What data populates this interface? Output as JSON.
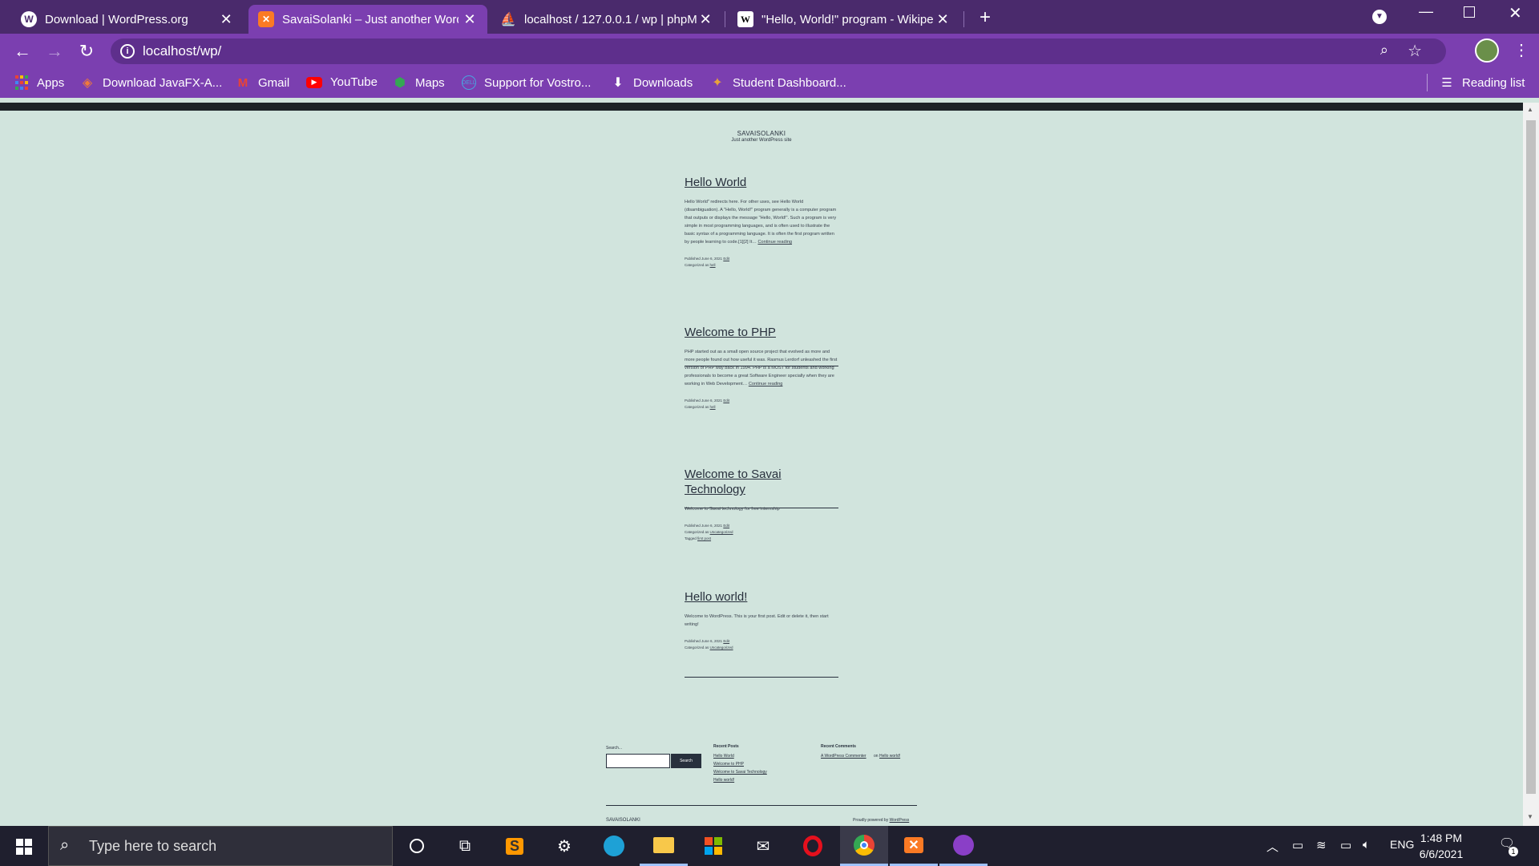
{
  "browser": {
    "tabs": [
      {
        "title": "Download | WordPress.org",
        "icon": "wordpress-icon",
        "active": false
      },
      {
        "title": "SavaiSolanki – Just another Word",
        "icon": "xampp-icon",
        "active": true
      },
      {
        "title": "localhost / 127.0.0.1 / wp | phpM",
        "icon": "phpmyadmin-icon",
        "active": false
      },
      {
        "title": "\"Hello, World!\" program - Wikipe",
        "icon": "wikipedia-icon",
        "active": false
      }
    ],
    "new_tab_symbol": "+",
    "url": "localhost/wp/"
  },
  "bookmarks": {
    "items": [
      {
        "label": "Apps",
        "icon": "apps-grid-icon"
      },
      {
        "label": "Download JavaFX-A...",
        "icon": "diamond-icon"
      },
      {
        "label": "Gmail",
        "icon": "gmail-icon"
      },
      {
        "label": "YouTube",
        "icon": "youtube-icon"
      },
      {
        "label": "Maps",
        "icon": "maps-icon"
      },
      {
        "label": "Support for Vostro...",
        "icon": "dell-icon"
      },
      {
        "label": "Downloads",
        "icon": "download-icon"
      },
      {
        "label": "Student Dashboard...",
        "icon": "dashboard-icon"
      }
    ],
    "reading_list": "Reading list"
  },
  "site": {
    "title": "SAVAISOLANKI",
    "description": "Just another WordPress site"
  },
  "posts": [
    {
      "title": "Hello World",
      "excerpt": "Hello World\" redirects here. For other uses, see Hello World (disambiguation). A \"Hello, World!\" program generally is a computer program that outputs or displays the message \"Hello, World!\". Such a program is very simple in most programming languages, and is often used to illustrate the basic syntax of a programming language. It is often the first program written by people learning to code.[1][2] It…",
      "continue": "Continue reading",
      "published": "Published June 6, 2021",
      "edit": "Edit",
      "categorized": "Categorized as",
      "category": "hell",
      "tagged": "",
      "tag": ""
    },
    {
      "title": "Welcome to PHP",
      "excerpt": "PHP started out as a small open source project that evolved as more and more people found out how useful it was. Rasmus Lerdorf unleashed the first version of PHP way back in 1994. PHP is a MUST for students and working professionals to become a great Software Engineer specially when they are working in Web Development…",
      "continue": "Continue reading",
      "published": "Published June 6, 2021",
      "edit": "Edit",
      "categorized": "Categorized as",
      "category": "hell",
      "tagged": "",
      "tag": ""
    },
    {
      "title": "Welcome to Savai Technology",
      "excerpt": "Welcome to Savai technology for free internship",
      "continue": "",
      "published": "Published June 6, 2021",
      "edit": "Edit",
      "categorized": "Categorized as",
      "category": "Uncategorized",
      "tagged": "Tagged",
      "tag": "first post"
    },
    {
      "title": "Hello world!",
      "excerpt": "Welcome to WordPress. This is your first post. Edit or delete it, then start writing!",
      "continue": "",
      "published": "Published June 6, 2021",
      "edit": "Edit",
      "categorized": "Categorized as",
      "category": "Uncategorized",
      "tagged": "",
      "tag": ""
    }
  ],
  "footer": {
    "search_label": "Search...",
    "search_button": "Search",
    "recent_posts_title": "Recent Posts",
    "recent_posts": [
      "Hello World",
      "Welcome to PHP",
      "Welcome to Savai Technology",
      "Hello world!"
    ],
    "recent_comments_title": "Recent Comments",
    "comment_author": "A WordPress Commenter",
    "comment_on": "on",
    "comment_post": "Hello world!",
    "site_name": "SAVAISOLANKI",
    "powered_by": "Proudly powered by",
    "powered_link": "WordPress"
  },
  "taskbar": {
    "search_placeholder": "Type here to search",
    "apps": [
      "cortana-icon",
      "task-view-icon",
      "sublime-text-icon",
      "settings-icon",
      "edge-icon",
      "file-explorer-icon",
      "store-icon",
      "mail-icon",
      "opera-icon",
      "chrome-icon",
      "xampp-icon",
      "github-desktop-icon"
    ],
    "language": "ENG",
    "time": "1:48 PM",
    "date": "6/6/2021",
    "notifications": "1"
  },
  "colors": {
    "tab_strip": "#4a2a6c",
    "toolbar": "#7b3fb0",
    "page_background": "#d1e4dd",
    "text": "#28303d",
    "taskbar": "#1f1f2e"
  }
}
